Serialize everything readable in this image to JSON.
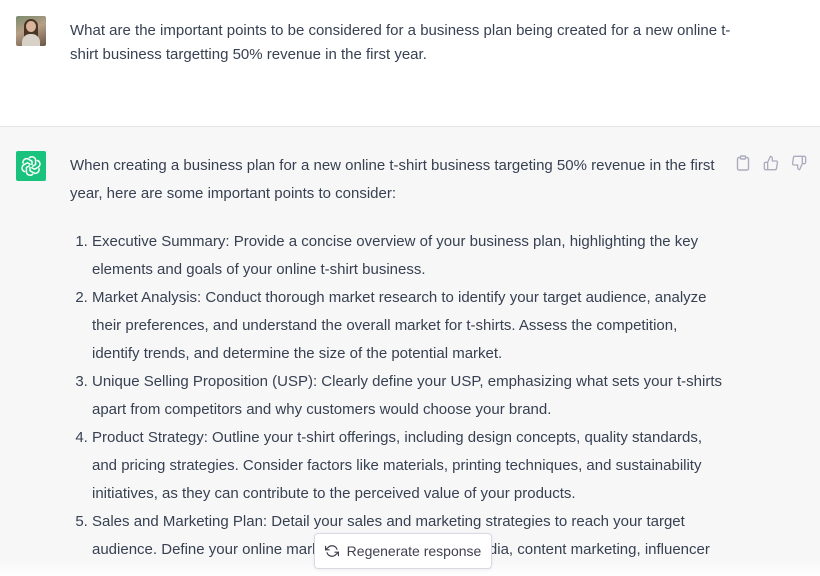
{
  "user_message": {
    "text": "What are the important points to be considered for a business plan being created for a new online t-shirt business targetting 50% revenue in the first year."
  },
  "assistant_message": {
    "intro": "When creating a business plan for a new online t-shirt business targeting 50% revenue in the first year, here are some important points to consider:",
    "points": [
      "Executive Summary: Provide a concise overview of your business plan, highlighting the key elements and goals of your online t-shirt business.",
      "Market Analysis: Conduct thorough market research to identify your target audience, analyze their preferences, and understand the overall market for t-shirts. Assess the competition, identify trends, and determine the size of the potential market.",
      "Unique Selling Proposition (USP): Clearly define your USP, emphasizing what sets your t-shirts apart from competitors and why customers would choose your brand.",
      "Product Strategy: Outline your t-shirt offerings, including design concepts, quality standards, and pricing strategies. Consider factors like materials, printing techniques, and sustainability initiatives, as they can contribute to the perceived value of your products.",
      "Sales and Marketing Plan: Detail your sales and marketing strategies to reach your target audience.",
      "Define your online marketing channels (social media, content marketing, influencer"
    ]
  },
  "actions": {
    "copy_icon": "clipboard-icon",
    "like_icon": "thumbs-up-icon",
    "dislike_icon": "thumbs-down-icon"
  },
  "regenerate": {
    "label": "Regenerate response",
    "icon": "refresh-icon"
  },
  "colors": {
    "assistant_bg": "#f7f7f8",
    "bot_avatar": "#19c37d",
    "text": "#374151"
  }
}
